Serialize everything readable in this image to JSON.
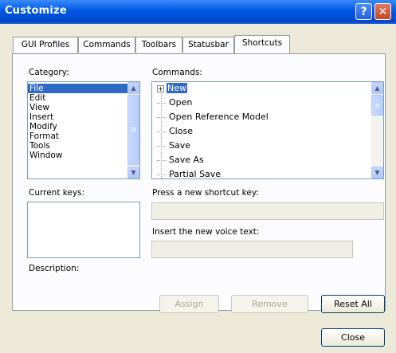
{
  "window": {
    "title": "Customize",
    "help_glyph": "?",
    "close_glyph": "✕"
  },
  "tabs": [
    "GUI Profiles",
    "Commands",
    "Toolbars",
    "Statusbar",
    "Shortcuts"
  ],
  "active_tab": "Shortcuts",
  "category": {
    "label": "Category:",
    "items": [
      "File",
      "Edit",
      "View",
      "Insert",
      "Modify",
      "Format",
      "Tools",
      "Window"
    ],
    "selected": "File"
  },
  "commands": {
    "label": "Commands:",
    "items": [
      "New",
      "Open",
      "Open Reference Model",
      "Close",
      "Save",
      "Save As",
      "Partial Save"
    ],
    "selected": "New",
    "expand_glyph": "+"
  },
  "current_keys": {
    "label": "Current keys:"
  },
  "shortcut": {
    "label": "Press a new shortcut key:",
    "value": ""
  },
  "voice": {
    "label": "Insert the new voice text:",
    "value": ""
  },
  "description": {
    "label": "Description:"
  },
  "buttons": {
    "assign": "Assign",
    "remove": "Remove",
    "reset_all": "Reset All",
    "close": "Close"
  },
  "scroll_arrows": {
    "up": "▲",
    "down": "▼"
  },
  "colors": {
    "titlebar": "#0058e6",
    "selection": "#316ac5",
    "dialog_bg": "#ece9d8"
  }
}
